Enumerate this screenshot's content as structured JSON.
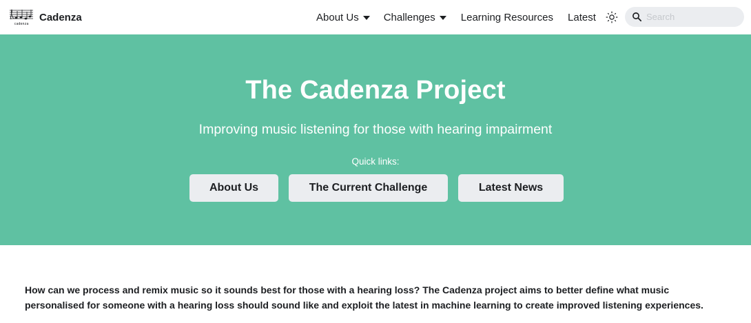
{
  "navbar": {
    "brand": {
      "title": "Cadenza",
      "logo_icon": "cadenza-logo",
      "logo_text": "cadenza"
    },
    "items": [
      {
        "label": "About Us",
        "dropdown": true
      },
      {
        "label": "Challenges",
        "dropdown": true
      },
      {
        "label": "Learning Resources",
        "dropdown": false
      },
      {
        "label": "Latest",
        "dropdown": false
      }
    ],
    "theme_toggle_icon": "sun-icon",
    "search": {
      "placeholder": "Search",
      "value": "",
      "icon": "search-icon"
    }
  },
  "hero": {
    "title": "The Cadenza Project",
    "subtitle": "Improving music listening for those with hearing impairment",
    "quick_links_label": "Quick links:",
    "buttons": [
      {
        "label": "About Us"
      },
      {
        "label": "The Current Challenge"
      },
      {
        "label": "Latest News"
      }
    ]
  },
  "intro": {
    "text": "How can we process and remix music so it sounds best for those with a hearing loss? The Cadenza project aims to better define what music personalised for someone with a hearing loss should sound like and exploit the latest in machine learning to create improved listening experiences."
  },
  "colors": {
    "hero_background": "#5fc1a2",
    "button_background": "#ebedf0",
    "text": "#1c1e21",
    "navbar_background": "#ffffff"
  }
}
